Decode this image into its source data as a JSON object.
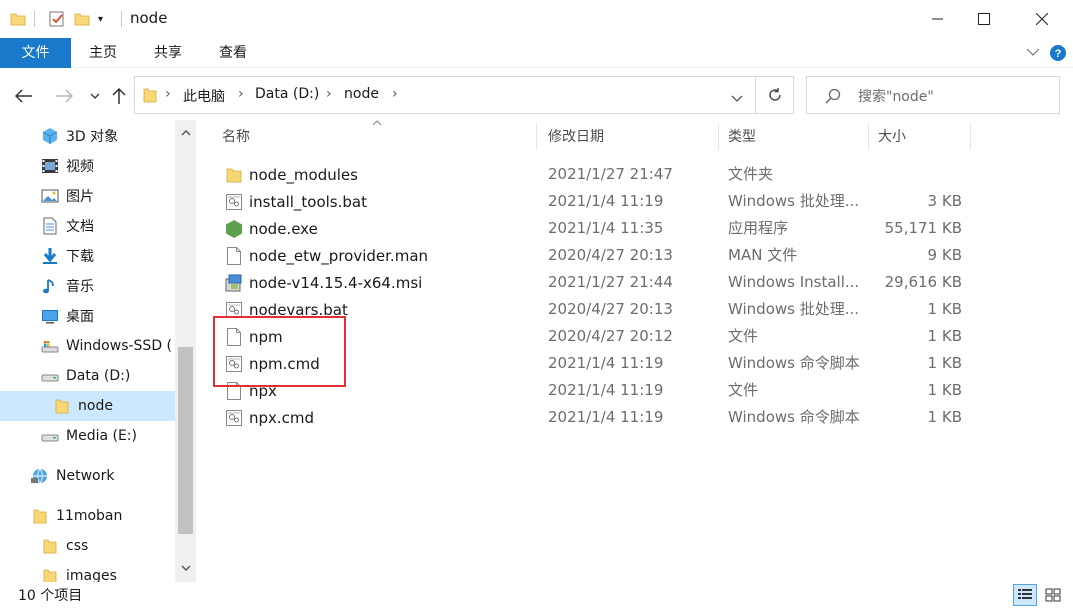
{
  "window": {
    "title": "node",
    "minimize_icon": "minimize-icon",
    "maximize_icon": "maximize-icon",
    "close_icon": "close-icon"
  },
  "ribbon": {
    "tabs": [
      "文件",
      "主页",
      "共享",
      "查看"
    ]
  },
  "address": {
    "segments": [
      "此电脑",
      "Data (D:)",
      "node"
    ]
  },
  "search": {
    "placeholder": "搜索\"node\""
  },
  "nav": {
    "items": [
      {
        "label": "3D 对象",
        "icon": "3d-objects-icon"
      },
      {
        "label": "视频",
        "icon": "video-icon"
      },
      {
        "label": "图片",
        "icon": "pictures-icon"
      },
      {
        "label": "文档",
        "icon": "documents-icon"
      },
      {
        "label": "下载",
        "icon": "downloads-icon"
      },
      {
        "label": "音乐",
        "icon": "music-icon"
      },
      {
        "label": "桌面",
        "icon": "desktop-icon"
      },
      {
        "label": "Windows-SSD (",
        "icon": "drive-c-icon"
      },
      {
        "label": "Data (D:)",
        "icon": "drive-icon"
      },
      {
        "label": "node",
        "icon": "folder-icon"
      },
      {
        "label": "Media (E:)",
        "icon": "drive-icon"
      },
      {
        "label": "Network",
        "icon": "network-icon"
      },
      {
        "label": "11moban",
        "icon": "folder-icon"
      },
      {
        "label": "css",
        "icon": "folder-icon"
      },
      {
        "label": "images",
        "icon": "folder-icon"
      }
    ]
  },
  "columns": {
    "name": "名称",
    "date": "修改日期",
    "type": "类型",
    "size": "大小"
  },
  "files": [
    {
      "name": "node_modules",
      "date": "2021/1/27 21:47",
      "type": "文件夹",
      "size": "",
      "icon": "folder-icon"
    },
    {
      "name": "install_tools.bat",
      "date": "2021/1/4 11:19",
      "type": "Windows 批处理...",
      "size": "3 KB",
      "icon": "batch-file-icon"
    },
    {
      "name": "node.exe",
      "date": "2021/1/4 11:35",
      "type": "应用程序",
      "size": "55,171 KB",
      "icon": "nodejs-icon"
    },
    {
      "name": "node_etw_provider.man",
      "date": "2020/4/27 20:13",
      "type": "MAN 文件",
      "size": "9 KB",
      "icon": "file-icon"
    },
    {
      "name": "node-v14.15.4-x64.msi",
      "date": "2021/1/27 21:44",
      "type": "Windows Install...",
      "size": "29,616 KB",
      "icon": "msi-installer-icon"
    },
    {
      "name": "nodevars.bat",
      "date": "2020/4/27 20:13",
      "type": "Windows 批处理...",
      "size": "1 KB",
      "icon": "batch-file-icon"
    },
    {
      "name": "npm",
      "date": "2020/4/27 20:12",
      "type": "文件",
      "size": "1 KB",
      "icon": "file-icon"
    },
    {
      "name": "npm.cmd",
      "date": "2021/1/4 11:19",
      "type": "Windows 命令脚本",
      "size": "1 KB",
      "icon": "batch-file-icon"
    },
    {
      "name": "npx",
      "date": "2021/1/4 11:19",
      "type": "文件",
      "size": "1 KB",
      "icon": "file-icon"
    },
    {
      "name": "npx.cmd",
      "date": "2021/1/4 11:19",
      "type": "Windows 命令脚本",
      "size": "1 KB",
      "icon": "batch-file-icon"
    }
  ],
  "status": {
    "count": "10 个项目"
  },
  "colors": {
    "accent": "#1979ca",
    "selection": "#cce8ff",
    "highlight_box": "#e03131",
    "folder": "#f8d775"
  }
}
